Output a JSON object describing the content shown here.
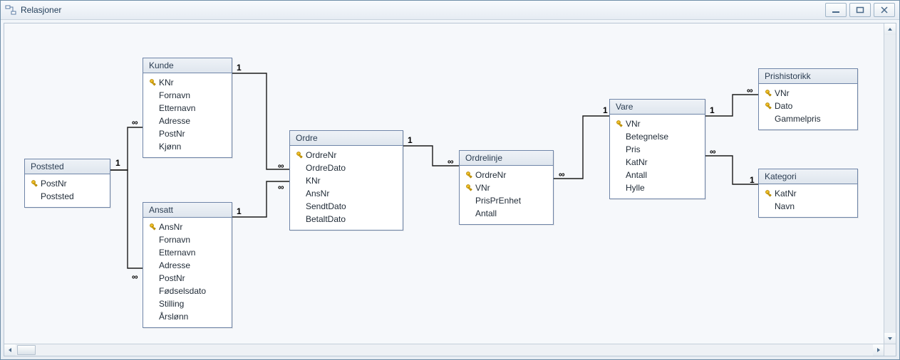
{
  "window": {
    "title": "Relasjoner"
  },
  "tables": {
    "poststed": {
      "title": "Poststed",
      "fields": [
        {
          "key": true,
          "name": "PostNr"
        },
        {
          "key": false,
          "name": "Poststed"
        }
      ]
    },
    "kunde": {
      "title": "Kunde",
      "fields": [
        {
          "key": true,
          "name": "KNr"
        },
        {
          "key": false,
          "name": "Fornavn"
        },
        {
          "key": false,
          "name": "Etternavn"
        },
        {
          "key": false,
          "name": "Adresse"
        },
        {
          "key": false,
          "name": "PostNr"
        },
        {
          "key": false,
          "name": "Kjønn"
        }
      ]
    },
    "ansatt": {
      "title": "Ansatt",
      "fields": [
        {
          "key": true,
          "name": "AnsNr"
        },
        {
          "key": false,
          "name": "Fornavn"
        },
        {
          "key": false,
          "name": "Etternavn"
        },
        {
          "key": false,
          "name": "Adresse"
        },
        {
          "key": false,
          "name": "PostNr"
        },
        {
          "key": false,
          "name": "Fødselsdato"
        },
        {
          "key": false,
          "name": "Stilling"
        },
        {
          "key": false,
          "name": "Årslønn"
        }
      ]
    },
    "ordre": {
      "title": "Ordre",
      "fields": [
        {
          "key": true,
          "name": "OrdreNr"
        },
        {
          "key": false,
          "name": "OrdreDato"
        },
        {
          "key": false,
          "name": "KNr"
        },
        {
          "key": false,
          "name": "AnsNr"
        },
        {
          "key": false,
          "name": "SendtDato"
        },
        {
          "key": false,
          "name": "BetaltDato"
        }
      ]
    },
    "ordrelinje": {
      "title": "Ordrelinje",
      "fields": [
        {
          "key": true,
          "name": "OrdreNr"
        },
        {
          "key": true,
          "name": "VNr"
        },
        {
          "key": false,
          "name": "PrisPrEnhet"
        },
        {
          "key": false,
          "name": "Antall"
        }
      ]
    },
    "vare": {
      "title": "Vare",
      "fields": [
        {
          "key": true,
          "name": "VNr"
        },
        {
          "key": false,
          "name": "Betegnelse"
        },
        {
          "key": false,
          "name": "Pris"
        },
        {
          "key": false,
          "name": "KatNr"
        },
        {
          "key": false,
          "name": "Antall"
        },
        {
          "key": false,
          "name": "Hylle"
        }
      ]
    },
    "prishistorikk": {
      "title": "Prishistorikk",
      "fields": [
        {
          "key": true,
          "name": "VNr"
        },
        {
          "key": true,
          "name": "Dato"
        },
        {
          "key": false,
          "name": "Gammelpris"
        }
      ]
    },
    "kategori": {
      "title": "Kategori",
      "fields": [
        {
          "key": true,
          "name": "KatNr"
        },
        {
          "key": false,
          "name": "Navn"
        }
      ]
    }
  },
  "relationships": [
    {
      "from": "poststed",
      "fromField": "PostNr",
      "fromCard": "1",
      "to": "kunde",
      "toField": "PostNr",
      "toCard": "∞"
    },
    {
      "from": "poststed",
      "fromField": "PostNr",
      "fromCard": "1",
      "to": "ansatt",
      "toField": "PostNr",
      "toCard": "∞"
    },
    {
      "from": "kunde",
      "fromField": "KNr",
      "fromCard": "1",
      "to": "ordre",
      "toField": "KNr",
      "toCard": "∞"
    },
    {
      "from": "ansatt",
      "fromField": "AnsNr",
      "fromCard": "1",
      "to": "ordre",
      "toField": "AnsNr",
      "toCard": "∞"
    },
    {
      "from": "ordre",
      "fromField": "OrdreNr",
      "fromCard": "1",
      "to": "ordrelinje",
      "toField": "OrdreNr",
      "toCard": "∞"
    },
    {
      "from": "vare",
      "fromField": "VNr",
      "fromCard": "1",
      "to": "ordrelinje",
      "toField": "VNr",
      "toCard": "∞"
    },
    {
      "from": "vare",
      "fromField": "VNr",
      "fromCard": "1",
      "to": "prishistorikk",
      "toField": "VNr",
      "toCard": "∞"
    },
    {
      "from": "vare",
      "fromField": "KatNr",
      "fromCard": "∞",
      "to": "kategori",
      "toField": "KatNr",
      "toCard": "1"
    }
  ],
  "card_labels": {
    "one": "1",
    "many": "∞"
  }
}
